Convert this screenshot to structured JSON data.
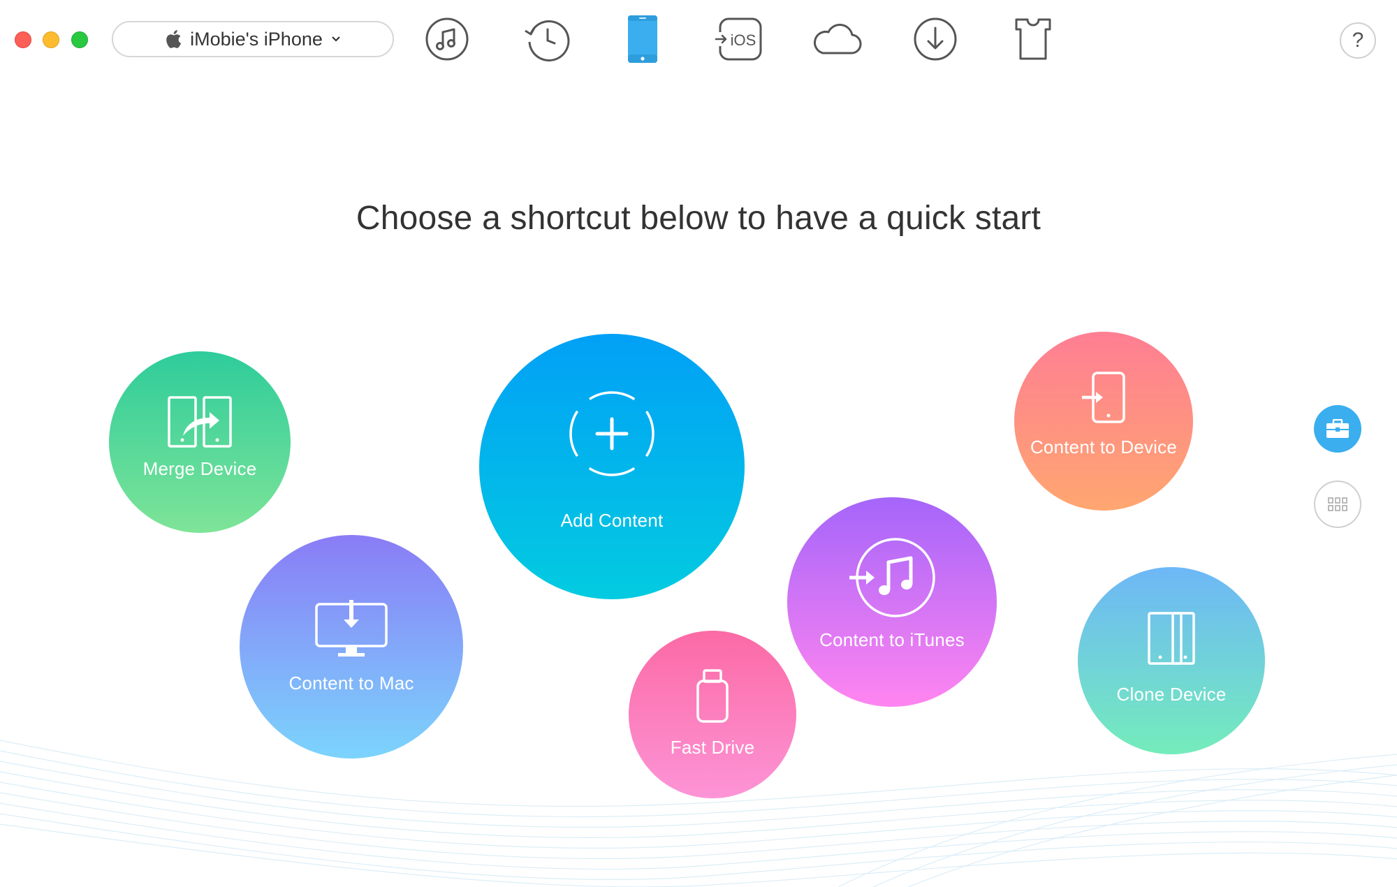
{
  "window": {
    "controls": [
      "close",
      "minimize",
      "zoom"
    ],
    "device_selector": {
      "icon": "apple-icon",
      "label": "iMobie's iPhone",
      "caret": "chevron-down-icon"
    }
  },
  "toolbar": {
    "items": [
      {
        "id": "music",
        "icon": "music-icon"
      },
      {
        "id": "history",
        "icon": "history-icon"
      },
      {
        "id": "device",
        "icon": "iphone-icon",
        "active": true,
        "active_color": "#3aaeef"
      },
      {
        "id": "ios-mover",
        "icon": "ios-import-icon",
        "text": "iOS"
      },
      {
        "id": "icloud",
        "icon": "cloud-icon"
      },
      {
        "id": "download",
        "icon": "download-icon"
      },
      {
        "id": "ringtone",
        "icon": "shirt-icon"
      }
    ],
    "help_label": "?"
  },
  "main": {
    "headline": "Choose a shortcut below to have a quick start",
    "shortcuts": [
      {
        "id": "merge-device",
        "label": "Merge Device",
        "icon": "merge-device-icon"
      },
      {
        "id": "add-content",
        "label": "Add Content",
        "icon": "add-content-icon"
      },
      {
        "id": "content-to-mac",
        "label": "Content to Mac",
        "icon": "monitor-download-icon"
      },
      {
        "id": "fast-drive",
        "label": "Fast Drive",
        "icon": "usb-drive-icon"
      },
      {
        "id": "content-to-itunes",
        "label": "Content to iTunes",
        "icon": "itunes-import-icon"
      },
      {
        "id": "content-to-device",
        "label": "Content to Device",
        "icon": "device-import-icon"
      },
      {
        "id": "clone-device",
        "label": "Clone Device",
        "icon": "clone-device-icon"
      }
    ]
  },
  "side": {
    "toolkit_view": {
      "icon": "toolbox-icon",
      "active": true
    },
    "grid_view": {
      "icon": "grid-icon",
      "active": false
    }
  },
  "colors": {
    "accent": "#3aaeef",
    "text": "#333333"
  }
}
